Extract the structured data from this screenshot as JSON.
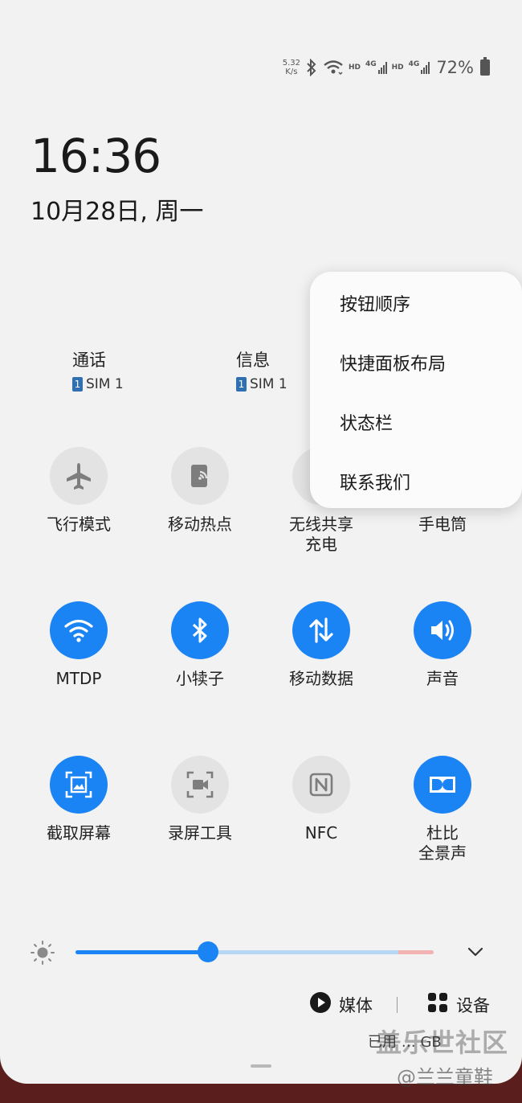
{
  "status_bar": {
    "net_speed_value": "5.32",
    "net_speed_unit": "K/s",
    "hd1": "HD",
    "lte1": "4G",
    "hd2": "HD",
    "lte2": "4G",
    "battery": "72%",
    "icons": [
      "bluetooth-icon",
      "wifi-icon",
      "signal-icon",
      "battery-charging-icon"
    ]
  },
  "clock": {
    "time": "16:36",
    "date": "10月28日, 周一"
  },
  "sim_cards": [
    {
      "title": "通话",
      "sim_number": "1",
      "sim_label": "SIM 1"
    },
    {
      "title": "信息",
      "sim_number": "1",
      "sim_label": "SIM 1"
    }
  ],
  "tiles": [
    {
      "label": "飞行模式",
      "icon": "airplane-icon",
      "state": "off"
    },
    {
      "label": "移动热点",
      "icon": "hotspot-icon",
      "state": "off"
    },
    {
      "label": "无线共享\n充电",
      "icon": "wireless-share-icon",
      "state": "off"
    },
    {
      "label": "手电筒",
      "icon": "flashlight-icon",
      "state": "off"
    },
    {
      "label": "MTDP",
      "icon": "wifi-icon",
      "state": "on"
    },
    {
      "label": "小犊子",
      "icon": "bluetooth-icon",
      "state": "on"
    },
    {
      "label": "移动数据",
      "icon": "mobile-data-icon",
      "state": "on"
    },
    {
      "label": "声音",
      "icon": "sound-icon",
      "state": "on"
    },
    {
      "label": "截取屏幕",
      "icon": "screenshot-icon",
      "state": "on"
    },
    {
      "label": "录屏工具",
      "icon": "screen-record-icon",
      "state": "off"
    },
    {
      "label": "NFC",
      "icon": "nfc-icon",
      "state": "off"
    },
    {
      "label": "杜比\n全景声",
      "icon": "dolby-icon",
      "state": "on"
    }
  ],
  "brightness": {
    "level": 0.37,
    "icon": "brightness-icon"
  },
  "bottom": {
    "media_label": "媒体",
    "devices_label": "设备",
    "storage_text": "已用 … GB"
  },
  "menu": {
    "items": [
      "按钮顺序",
      "快捷面板布局",
      "状态栏",
      "联系我们"
    ]
  },
  "watermark": {
    "main": "盖乐世社区",
    "sub": "@兰兰童鞋"
  },
  "colors": {
    "accent": "#1b84f4",
    "panel_bg": "#f2f2f2",
    "tile_off": "#e3e3e3"
  }
}
